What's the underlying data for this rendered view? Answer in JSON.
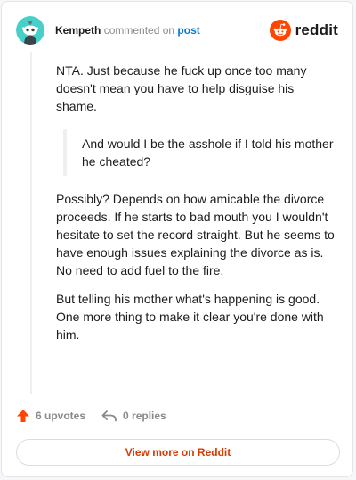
{
  "header": {
    "author": "Kempeth",
    "action_text": "commented on",
    "post_link": "post",
    "brand": "reddit"
  },
  "comment": {
    "paragraph_1": "NTA. Just because he fuck up once too many doesn't mean you have to help disguise his shame.",
    "quote": "And would I be the asshole if I told his mother he cheated?",
    "paragraph_2": "Possibly? Depends on how amicable the divorce proceeds. If he starts to bad mouth you I wouldn't hesitate to set the record straight. But he seems to have enough issues explaining the divorce as is. No need to add fuel to the fire.",
    "paragraph_3": "But telling his mother what's happening is good. One more thing to make it clear you're done with him."
  },
  "footer": {
    "upvotes": "6 upvotes",
    "replies": "0 replies"
  },
  "view_more_label": "View more on Reddit",
  "colors": {
    "brand_orange": "#ff4500",
    "avatar_teal": "#46d0c9",
    "link_blue": "#0079d3",
    "cta_orange": "#d93a00"
  },
  "icons": {
    "avatar": "snoo-avatar",
    "brand": "reddit-logo-icon",
    "upvote": "upvote-arrow-icon",
    "reply": "reply-arrow-icon"
  }
}
